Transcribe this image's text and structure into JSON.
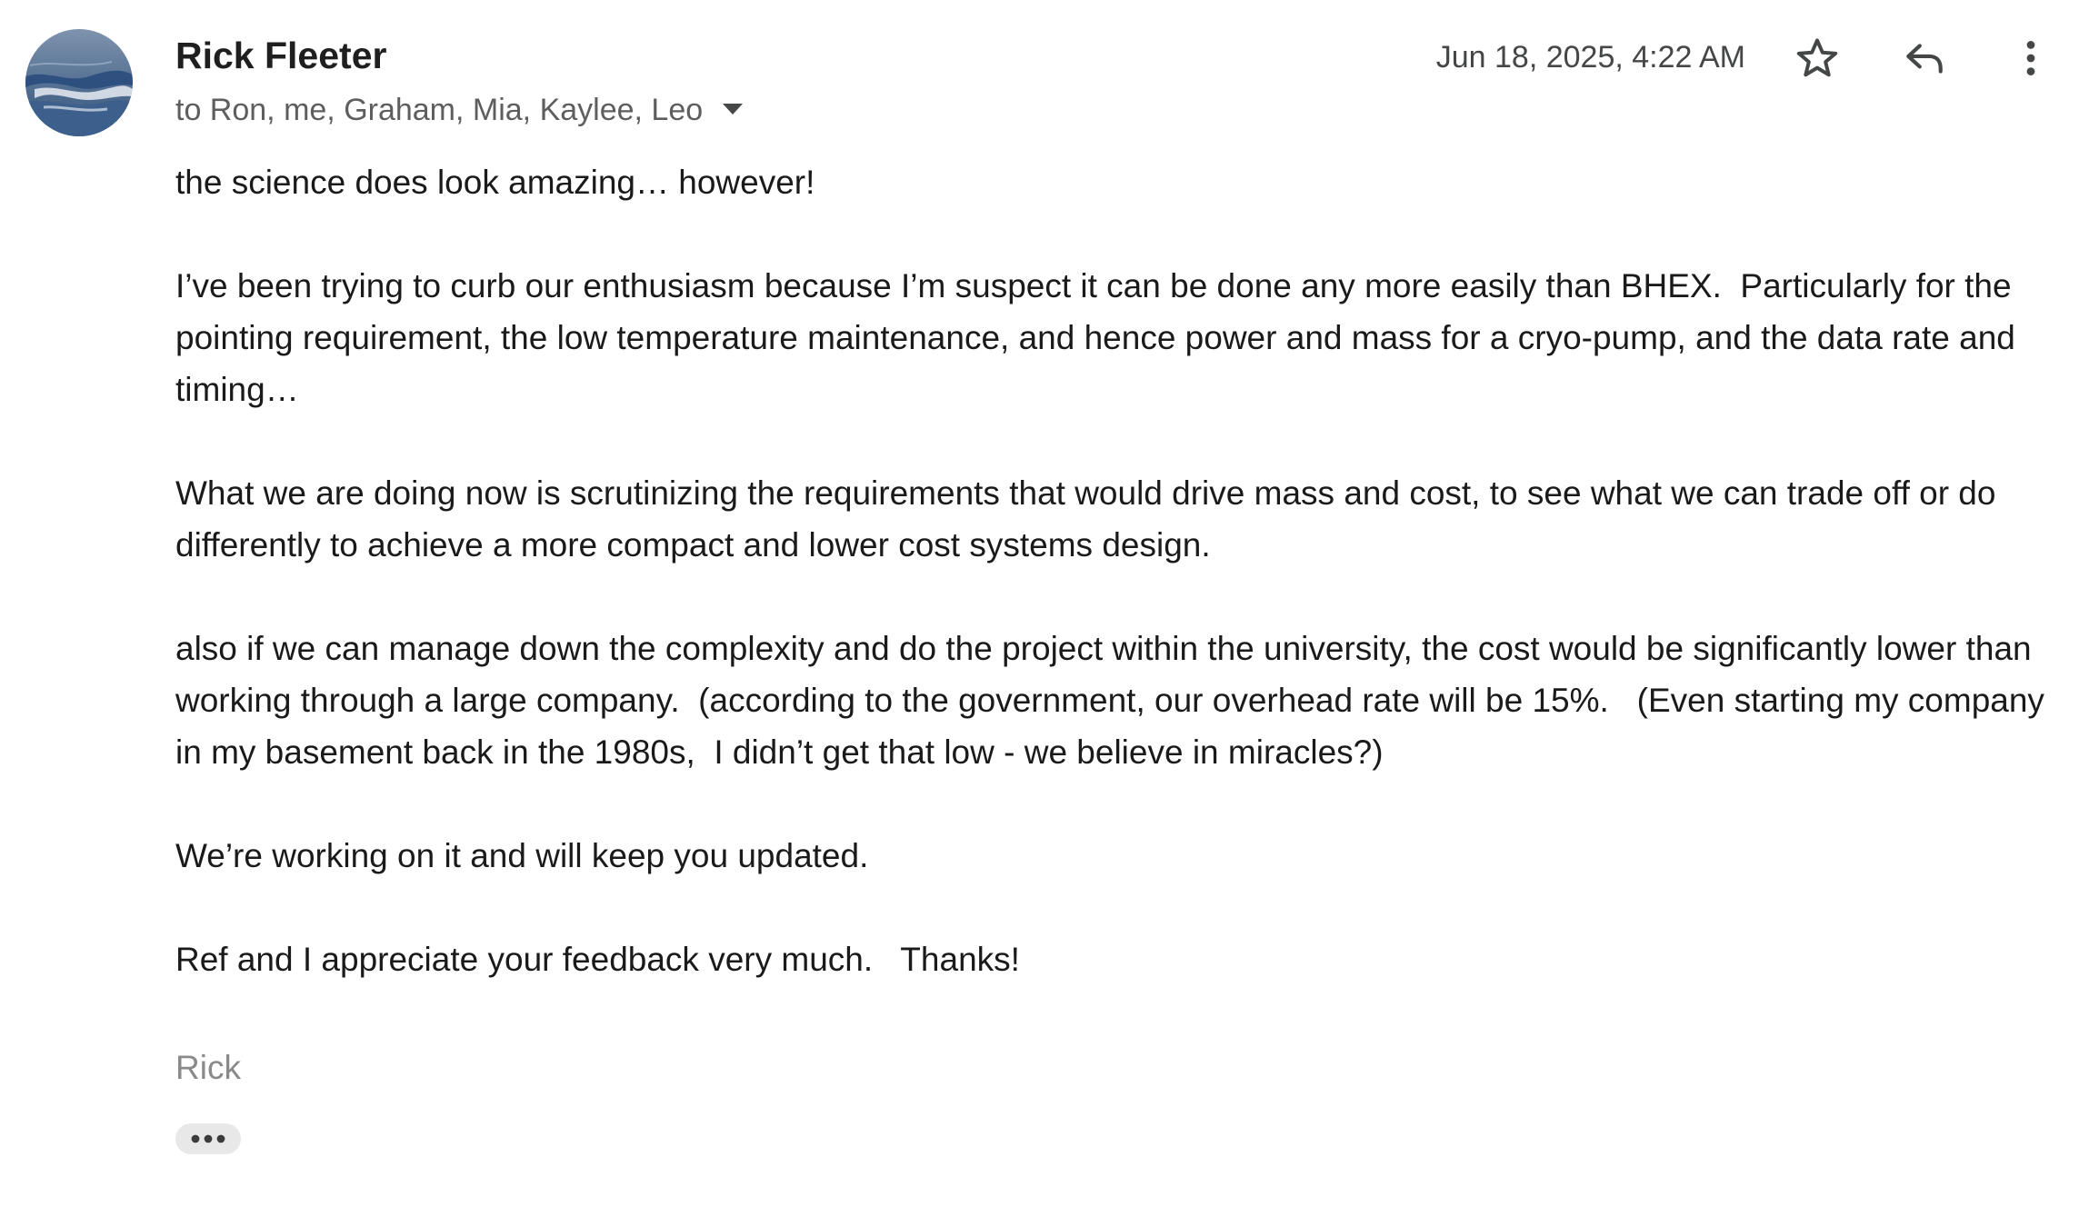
{
  "header": {
    "sender_name": "Rick Fleeter",
    "recipients": "to Ron, me, Graham, Mia, Kaylee, Leo",
    "date": "Jun 18, 2025, 4:22 AM"
  },
  "icons": {
    "avatar": "avatar-photo",
    "recipients_toggle": "caret-down-icon",
    "star": "star-icon",
    "reply": "reply-icon",
    "more": "more-vert-icon",
    "trimmed_content": "more-horiz-icon"
  },
  "body": {
    "paragraphs": [
      "the science does look amazing… however!",
      "I’ve been trying to curb our enthusiasm because I’m suspect it can be done any more easily than BHEX.  Particularly for the pointing requirement, the low temperature maintenance, and hence power and mass for a cryo-pump, and the data rate and timing…",
      "What we are doing now is scrutinizing the requirements that would drive mass and cost, to see what we can trade off or do differently to achieve a more compact and lower cost systems design.",
      "also if we can manage down the complexity and do the project within the university, the cost would be significantly lower than working through a large company.  (according to the government, our overhead rate will be 15%.   (Even starting my company in my basement back in the 1980s,  I didn’t get that low - we believe in miracles?)",
      "We’re working on it and will keep you updated.",
      "Ref and I appreciate your feedback very much.   Thanks!"
    ],
    "signature": "Rick"
  }
}
